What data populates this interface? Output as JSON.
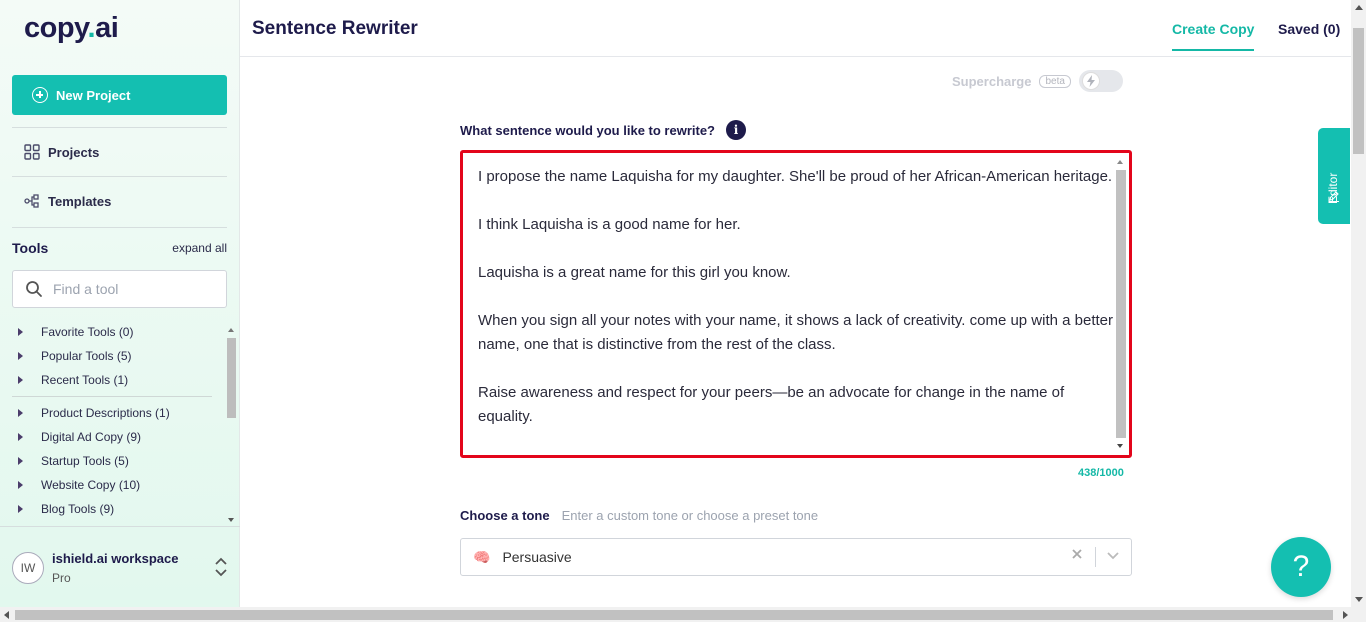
{
  "app": {
    "logo_main": "copy",
    "logo_dot": ".",
    "logo_end": "ai"
  },
  "sidebar": {
    "new_project_label": "New Project",
    "projects_label": "Projects",
    "templates_label": "Templates",
    "tools_title": "Tools",
    "expand_all": "expand all",
    "search_placeholder": "Find a tool",
    "tools": [
      "Favorite Tools (0)",
      "Popular Tools (5)",
      "Recent Tools (1)",
      "Product Descriptions (1)",
      "Digital Ad Copy (9)",
      "Startup Tools (5)",
      "Website Copy (10)",
      "Blog Tools (9)"
    ],
    "workspace": {
      "initials": "IW",
      "name": "ishield.ai workspace",
      "plan": "Pro"
    }
  },
  "header": {
    "title": "Sentence Rewriter",
    "tab_create": "Create Copy",
    "tab_saved": "Saved (0)"
  },
  "main": {
    "supercharge_label": "Supercharge",
    "beta_label": "beta",
    "question_label": "What sentence would you like to rewrite?",
    "info_icon": "i",
    "input_text": "I propose the name Laquisha for my daughter. She'll be proud of her African-American heritage.\n\nI think Laquisha is a good name for her.\n\nLaquisha is a great name for this girl you know.\n\nWhen you sign all your notes with your name, it shows a lack of creativity. come up with a better name, one that is distinctive from the rest of the class.\n\nRaise awareness and respect for your peers—be an advocate for change in the name of equality.",
    "char_counter": "438/1000",
    "tone_label": "Choose a tone",
    "tone_hint": "Enter a custom tone or choose a preset tone",
    "tone_value": "Persuasive",
    "tone_emoji": "🧠"
  },
  "editor_tab_label": "Editor",
  "help_label": "?",
  "colors": {
    "accent": "#14bfb1",
    "navy": "#1e1b4b",
    "highlight_border": "#e3051b"
  }
}
